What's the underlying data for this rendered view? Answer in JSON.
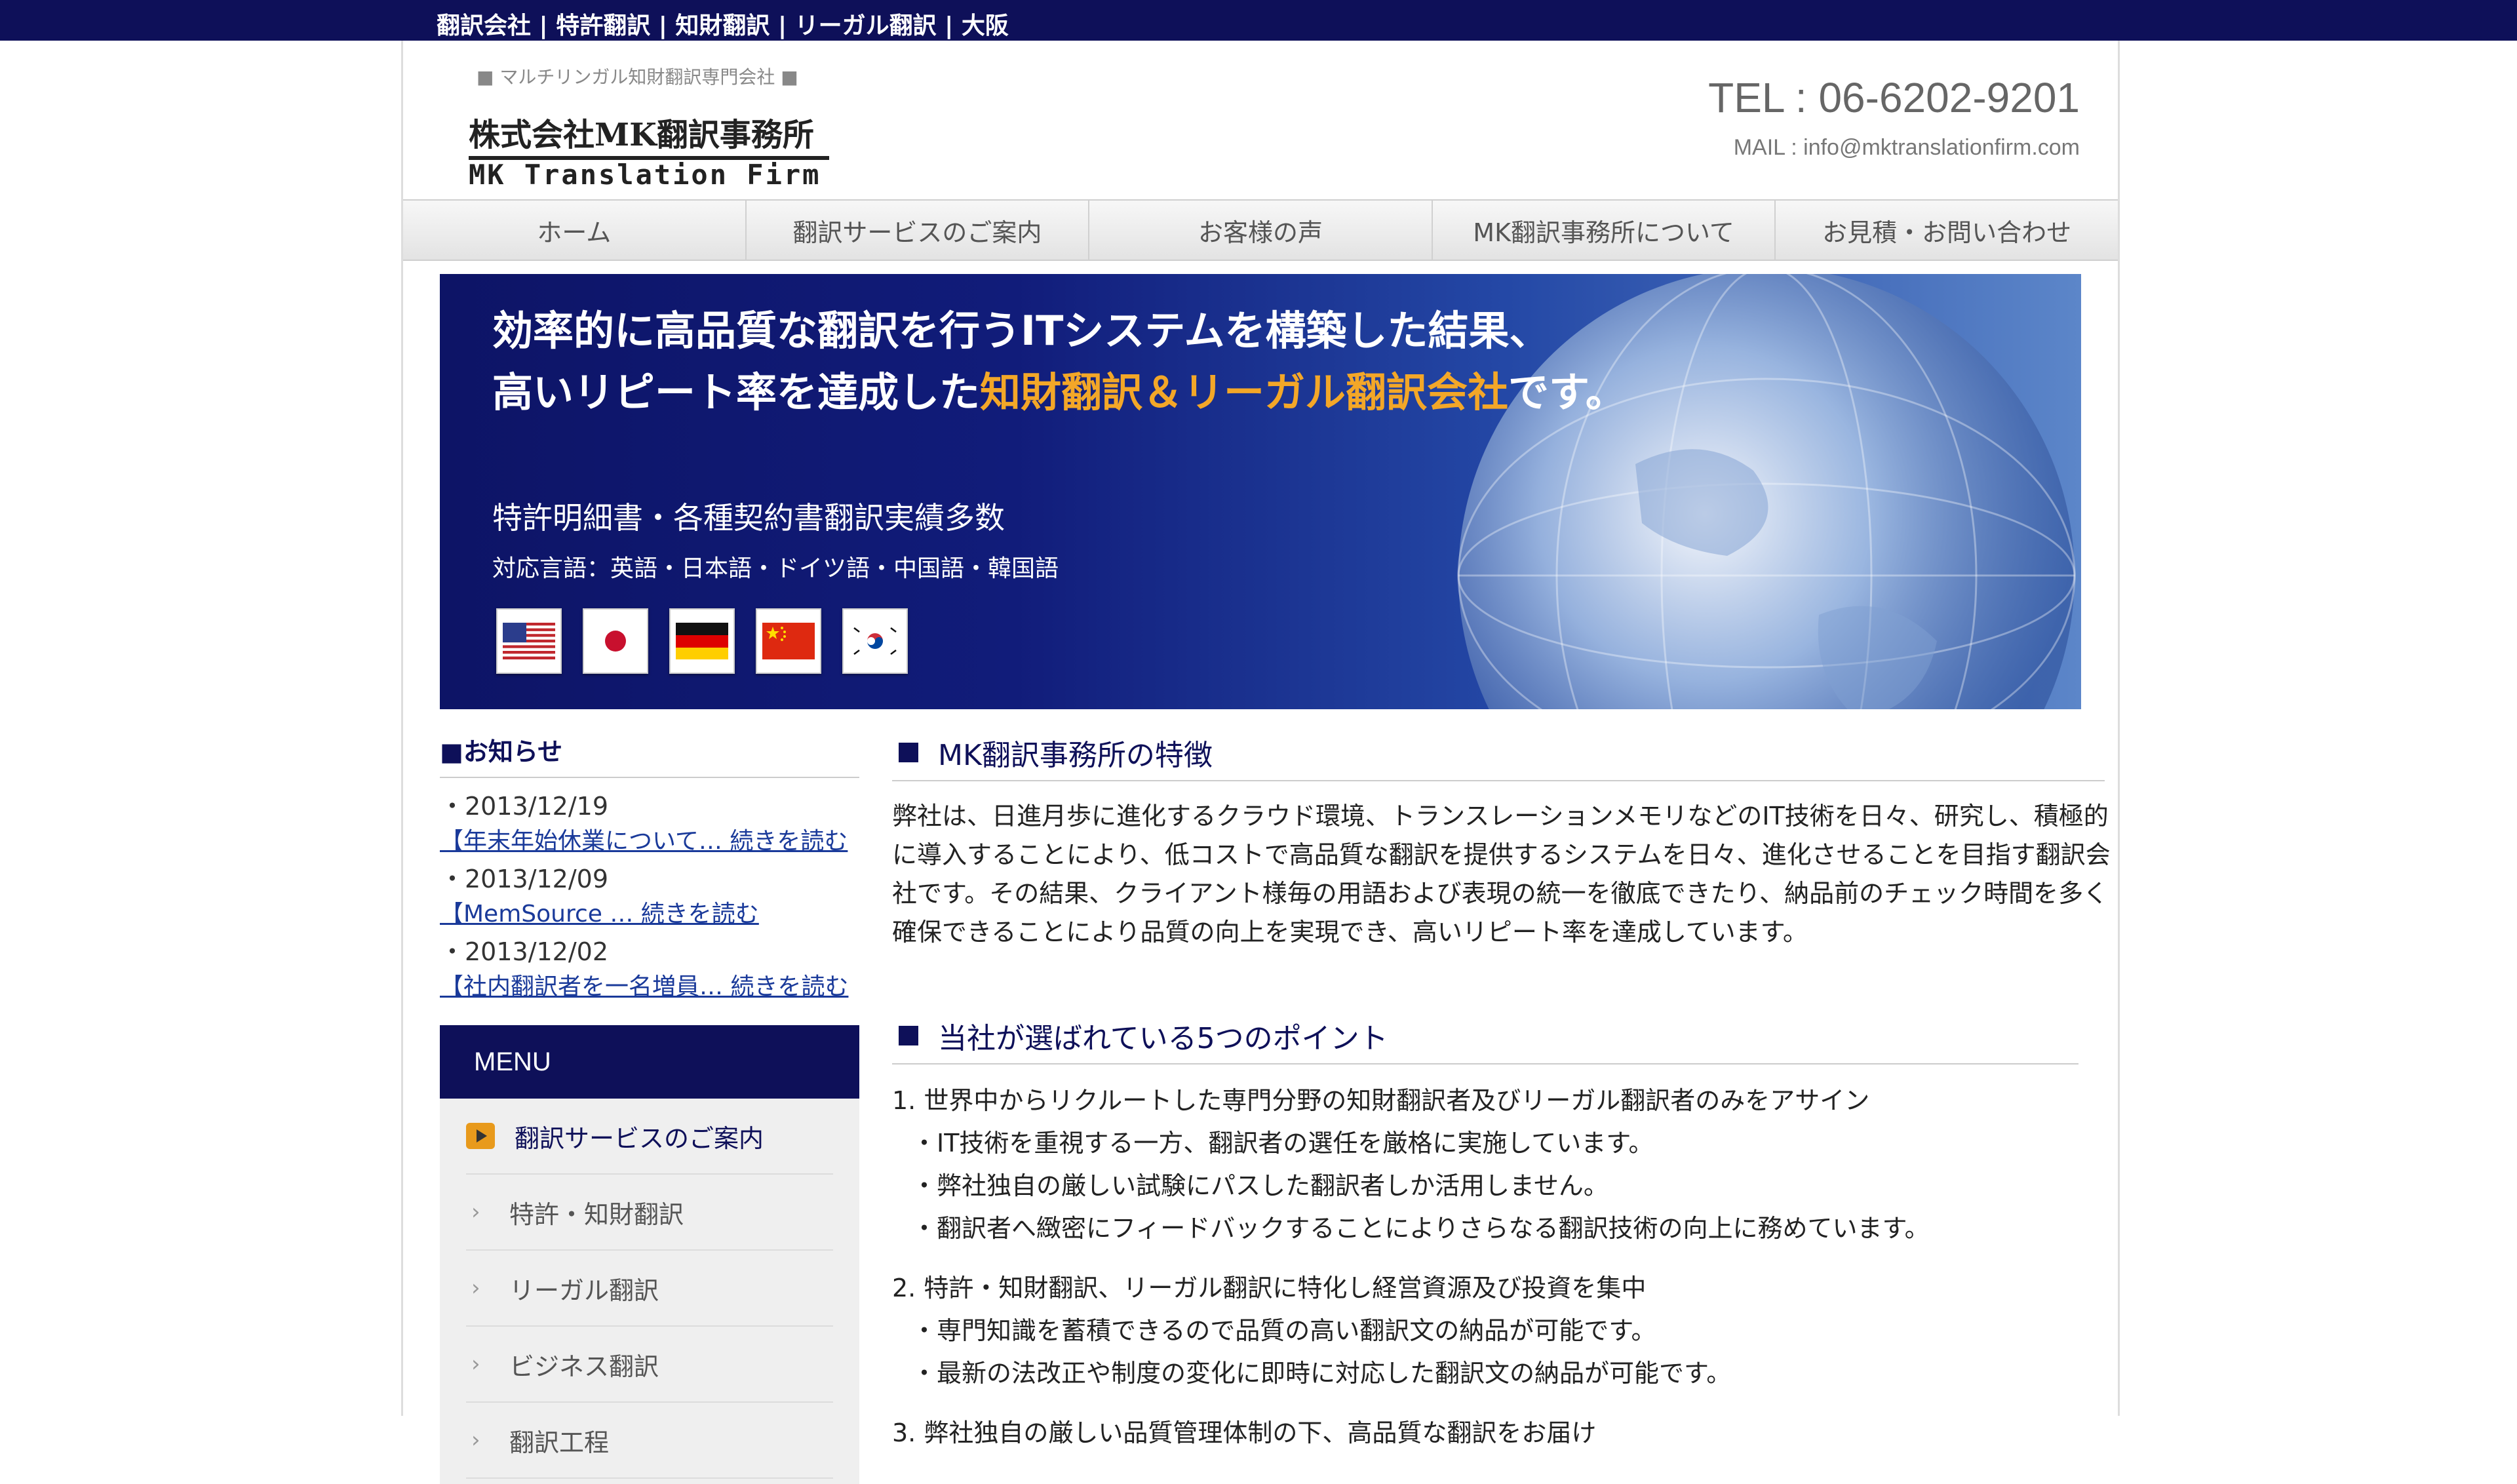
{
  "topbar": {
    "text": "翻訳会社 | 特許翻訳 | 知財翻訳 | リーガル翻訳 | 大阪"
  },
  "header": {
    "logo_tagline": "■ マルチリンガル知財翻訳専門会社 ■",
    "logo_name": "株式会社MK翻訳事務所",
    "logo_english": "MK Translation Firm",
    "tel": "TEL : 06-6202-9201",
    "mail": "MAIL : info@mktranslationfirm.com"
  },
  "nav": {
    "items": [
      {
        "label": "ホーム"
      },
      {
        "label": "翻訳サービスのご案内"
      },
      {
        "label": "お客様の声"
      },
      {
        "label": "MK翻訳事務所について"
      },
      {
        "label": "お見積・お問い合わせ"
      }
    ]
  },
  "hero": {
    "line1": "効率的に高品質な翻訳を行うITシステムを構築した結果、",
    "line2_prefix": "高いリピート率を達成した",
    "line2_highlight": "知財翻訳＆リーガル翻訳会社",
    "line2_suffix": "です。",
    "subtitle": "特許明細書・各種契約書翻訳実績多数",
    "languages": "対応言語：英語・日本語・ドイツ語・中国語・韓国語",
    "flags": [
      "us-flag",
      "japan-flag",
      "germany-flag",
      "china-flag",
      "korea-flag"
    ],
    "highlight_color": "#f3a728",
    "accent_color": "#0e1059"
  },
  "news": {
    "title": "■お知らせ",
    "items": [
      {
        "date": "・2013/12/19",
        "link": "【年末年始休業について…  続きを読む"
      },
      {
        "date": "・2013/12/09",
        "link": "【MemSource …  続きを読む"
      },
      {
        "date": "・2013/12/02",
        "link": "【社内翻訳者を一名増員…  続きを読む"
      }
    ]
  },
  "menu": {
    "title": "MENU",
    "items": [
      {
        "label": "翻訳サービスのご案内",
        "active": true
      },
      {
        "label": "特許・知財翻訳"
      },
      {
        "label": "リーガル翻訳"
      },
      {
        "label": "ビジネス翻訳"
      },
      {
        "label": "翻訳工程"
      }
    ]
  },
  "main": {
    "feature_title": "MK翻訳事務所の特徴",
    "feature_body": "弊社は、日進月歩に進化するクラウド環境、トランスレーションメモリなどのIT技術を日々、研究し、積極的に導入することにより、低コストで高品質な翻訳を提供するシステムを日々、進化させることを目指す翻訳会社です。その結果、クライアント様毎の用語および表現の統一を徹底できたり、納品前のチェック時間を多く確保できることにより品質の向上を実現でき、高いリピート率を達成しています。",
    "points_title": "当社が選ばれている5つのポイント",
    "points": [
      {
        "head": "1. 世界中からリクルートした専門分野の知財翻訳者及びリーガル翻訳者のみをアサイン",
        "bullets": [
          "・IT技術を重視する一方、翻訳者の選任を厳格に実施しています。",
          "・弊社独自の厳しい試験にパスした翻訳者しか活用しません。",
          "・翻訳者へ緻密にフィードバックすることによりさらなる翻訳技術の向上に務めています。"
        ]
      },
      {
        "head": "2. 特許・知財翻訳、リーガル翻訳に特化し経営資源及び投資を集中",
        "bullets": [
          "・専門知識を蓄積できるので品質の高い翻訳文の納品が可能です。",
          "・最新の法改正や制度の変化に即時に対応した翻訳文の納品が可能です。"
        ]
      },
      {
        "head": "3. 弊社独自の厳しい品質管理体制の下、高品質な翻訳をお届け",
        "bullets": []
      }
    ]
  }
}
